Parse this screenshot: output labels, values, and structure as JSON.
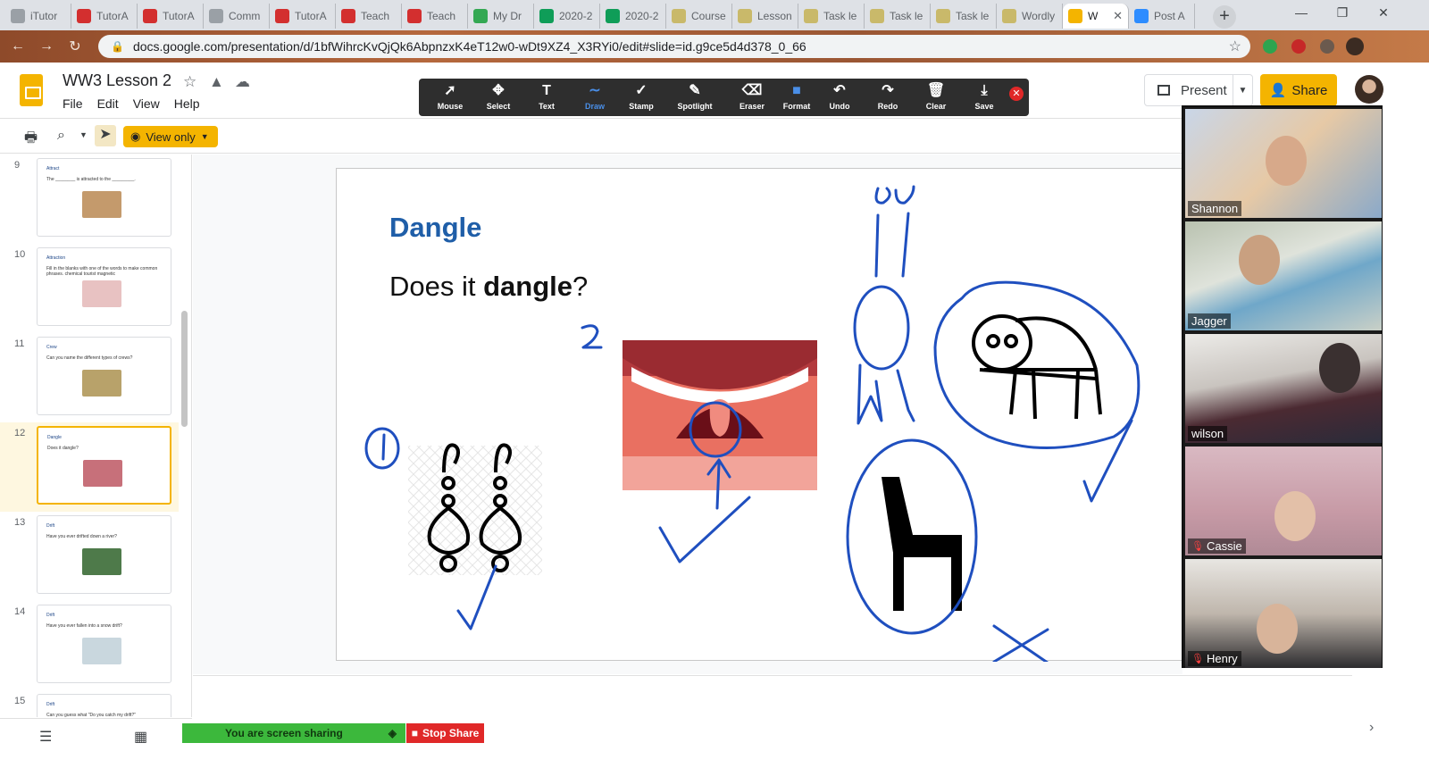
{
  "browser": {
    "tabs": [
      {
        "label": "iTutor",
        "icon": "globe-icon",
        "color": "#9aa0a6"
      },
      {
        "label": "TutorA",
        "icon": "tutor-icon",
        "color": "#d32f2f"
      },
      {
        "label": "TutorA",
        "icon": "tutor-icon",
        "color": "#d32f2f"
      },
      {
        "label": "Comm",
        "icon": "globe-icon",
        "color": "#9aa0a6"
      },
      {
        "label": "TutorA",
        "icon": "tutor-icon",
        "color": "#d32f2f"
      },
      {
        "label": "Teach",
        "icon": "tutor-icon",
        "color": "#d32f2f"
      },
      {
        "label": "Teach",
        "icon": "tutor-icon",
        "color": "#d32f2f"
      },
      {
        "label": "My Dr",
        "icon": "drive-icon",
        "color": "#34a853"
      },
      {
        "label": "2020-2",
        "icon": "sheets-icon",
        "color": "#0f9d58"
      },
      {
        "label": "2020-2",
        "icon": "sheets-icon",
        "color": "#0f9d58"
      },
      {
        "label": "Course",
        "icon": "course-icon",
        "color": "#c9b96a"
      },
      {
        "label": "Lesson",
        "icon": "course-icon",
        "color": "#c9b96a"
      },
      {
        "label": "Task le",
        "icon": "course-icon",
        "color": "#c9b96a"
      },
      {
        "label": "Task le",
        "icon": "course-icon",
        "color": "#c9b96a"
      },
      {
        "label": "Task le",
        "icon": "course-icon",
        "color": "#c9b96a"
      },
      {
        "label": "Wordly",
        "icon": "course-icon",
        "color": "#c9b96a"
      },
      {
        "label": "W",
        "icon": "slides-icon",
        "color": "#f4b400"
      },
      {
        "label": "Post A",
        "icon": "zoom-icon",
        "color": "#2d8cff"
      }
    ],
    "url": "docs.google.com/presentation/d/1bfWihrcKvQjQk6AbpnzxK4eT12w0-wDt9XZ4_X3RYi0/edit#slide=id.g9ce5d4d378_0_66"
  },
  "doc": {
    "title": "WW3 Lesson 2",
    "menu": [
      "File",
      "Edit",
      "View",
      "Help"
    ],
    "present_label": "Present",
    "share_label": "Share",
    "view_only_label": "View only"
  },
  "annotate": {
    "tools": [
      {
        "label": "Mouse",
        "glyph": "➚"
      },
      {
        "label": "Select",
        "glyph": "✥"
      },
      {
        "label": "Text",
        "glyph": "T"
      },
      {
        "label": "Draw",
        "glyph": "∼"
      },
      {
        "label": "Stamp",
        "glyph": "✓"
      },
      {
        "label": "Spotlight",
        "glyph": "✎"
      },
      {
        "label": "Eraser",
        "glyph": "⌫"
      },
      {
        "label": "Format",
        "glyph": "■"
      },
      {
        "label": "Undo",
        "glyph": "↶"
      },
      {
        "label": "Redo",
        "glyph": "↷"
      },
      {
        "label": "Clear",
        "glyph": "🗑"
      },
      {
        "label": "Save",
        "glyph": "⤓"
      }
    ],
    "active": "Draw",
    "accent": "#4a8fe8"
  },
  "filmstrip": {
    "slides": [
      {
        "num": "9",
        "title": "Attract",
        "text": "The ________ is attracted to the _________."
      },
      {
        "num": "10",
        "title": "Attraction",
        "text": "Fill in the blanks with one of the words to make common phrases.   chemical   tourist   magnetic"
      },
      {
        "num": "11",
        "title": "Crew",
        "text": "Can you name the different types of crews?"
      },
      {
        "num": "12",
        "title": "Dangle",
        "text": "Does it dangle?"
      },
      {
        "num": "13",
        "title": "Drift",
        "text": "Have you ever drifted down a river?"
      },
      {
        "num": "14",
        "title": "Drift",
        "text": "Have you ever fallen into a snow drift?"
      },
      {
        "num": "15",
        "title": "Drift",
        "text": "Can you guess what \"Do you catch my drift?\""
      }
    ],
    "selected": "12"
  },
  "slide": {
    "title": "Dangle",
    "body_prefix": "Does it ",
    "body_bold": "dangle",
    "body_suffix": "?",
    "annotation_color": "#1f4fbf"
  },
  "zoom": {
    "sharing_label": "You are screen sharing",
    "stop_label": "Stop Share",
    "participants": [
      {
        "name": "Shannon",
        "muted": false
      },
      {
        "name": "Jagger",
        "muted": false
      },
      {
        "name": "wilson",
        "muted": false
      },
      {
        "name": "Cassie",
        "muted": true
      },
      {
        "name": "Henry",
        "muted": true
      }
    ]
  }
}
